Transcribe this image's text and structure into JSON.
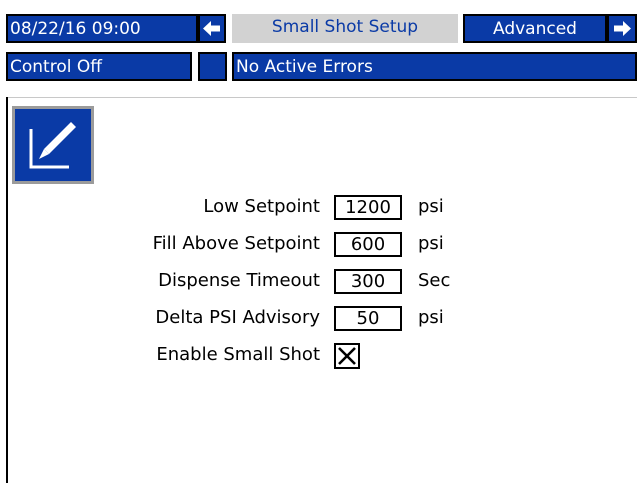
{
  "header": {
    "datetime": "08/22/16 09:00",
    "prev_icon": "arrow-left-icon",
    "active_tab": "Small Shot Setup",
    "next_tab": "Advanced",
    "next_icon": "arrow-right-icon"
  },
  "status": {
    "control": "Control Off",
    "errors": "No Active Errors"
  },
  "edit_button": {
    "icon": "edit-pencil-icon"
  },
  "fields": [
    {
      "label": "Low Setpoint",
      "value": "1200",
      "unit": "psi"
    },
    {
      "label": "Fill Above Setpoint",
      "value": "600",
      "unit": "psi"
    },
    {
      "label": "Dispense Timeout",
      "value": "300",
      "unit": "Sec"
    },
    {
      "label": "Delta PSI Advisory",
      "value": "50",
      "unit": "psi"
    }
  ],
  "small_shot": {
    "label": "Enable Small Shot",
    "checked": true
  },
  "colors": {
    "bar_blue": "#0a3aa6",
    "tab_grey": "#d2d2d2",
    "text_white": "#ffffff"
  }
}
